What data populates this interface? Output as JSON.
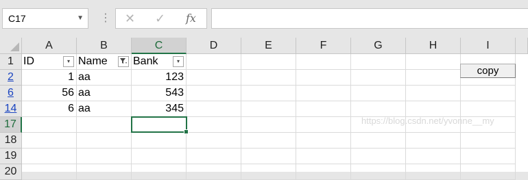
{
  "formula_bar": {
    "name_box": "C17",
    "cancel_icon": "✕",
    "enter_icon": "✓",
    "fx_label": "fx",
    "formula_value": ""
  },
  "columns": [
    "A",
    "B",
    "C",
    "D",
    "E",
    "F",
    "G",
    "H",
    "I"
  ],
  "rows": [
    {
      "header": "1",
      "cells": {
        "A": "ID",
        "B": "Name",
        "C": "Bank"
      }
    },
    {
      "header": "2",
      "cells": {
        "A": "1",
        "B": "aa",
        "C": "123"
      }
    },
    {
      "header": "6",
      "cells": {
        "A": "56",
        "B": "aa",
        "C": "543"
      }
    },
    {
      "header": "14",
      "cells": {
        "A": "6",
        "B": "aa",
        "C": "345"
      }
    },
    {
      "header": "17",
      "cells": {}
    },
    {
      "header": "18",
      "cells": {}
    },
    {
      "header": "19",
      "cells": {}
    },
    {
      "header": "20",
      "cells": {}
    }
  ],
  "active_cell": "C17",
  "filter_icons": {
    "A": "▾",
    "B": "▾",
    "C": "▾"
  },
  "filter_active_column": "B",
  "sheet_button": {
    "label": "copy"
  },
  "watermark": "https://blog.csdn.net/yvonne__my",
  "colors": {
    "accent": "#217346",
    "filtered_row": "#1a44c0"
  }
}
